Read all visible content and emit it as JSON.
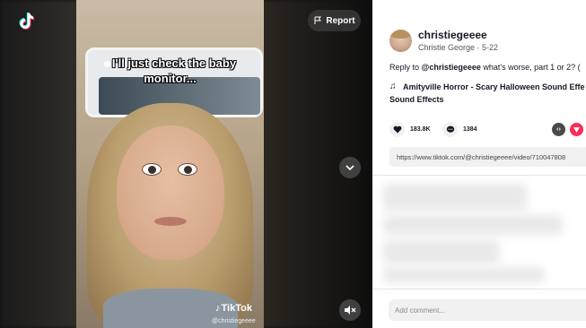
{
  "video": {
    "caption": "I'll just check the baby monitor...",
    "watermark_brand": "TikTok",
    "watermark_user": "@christiegeeee"
  },
  "controls": {
    "report_label": "Report"
  },
  "panel": {
    "username": "christiegeeee",
    "display_name": "Christie George",
    "date": "5-22",
    "description_prefix": "Reply to",
    "description_mention": "@christiegeeee",
    "description_text": "what's worse, part 1 or 2? (",
    "music_line1": "Amityville Horror - Scary Halloween Sound Effe",
    "music_line2": "Sound Effects",
    "likes": "183.8K",
    "comments": "1384",
    "share_url": "https://www.tiktok.com/@christiegeeee/video/710047808",
    "comment_placeholder": "Add comment..."
  },
  "colors": {
    "accent": "#fe2c55",
    "panel_bg": "#ffffff",
    "stage_bg": "#111111"
  },
  "icons": [
    "tiktok-logo-icon",
    "flag-icon",
    "chevron-down-icon",
    "mute-icon",
    "heart-icon",
    "comment-icon",
    "embed-icon",
    "share-icon",
    "music-note-icon"
  ]
}
